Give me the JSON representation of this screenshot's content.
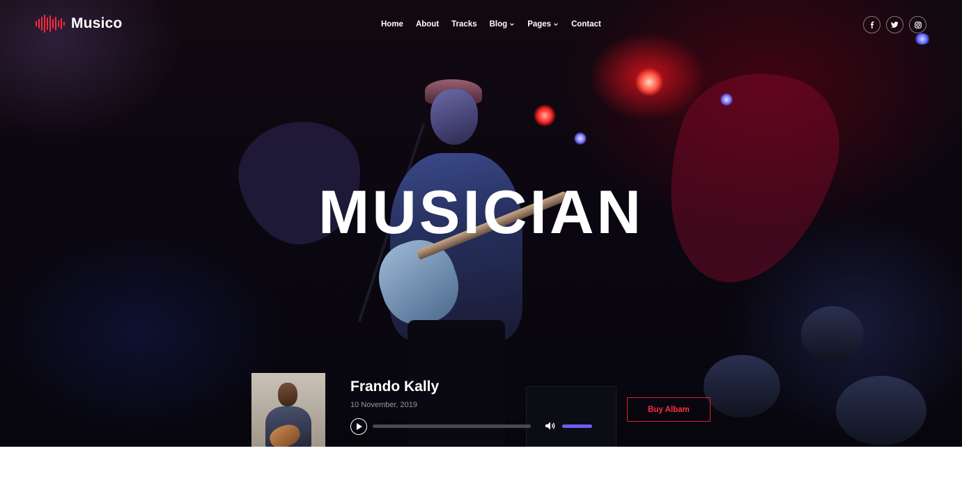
{
  "brand": {
    "name": "Musico",
    "accent": "#ff2a3c"
  },
  "nav": {
    "items": [
      {
        "label": "Home",
        "dropdown": false
      },
      {
        "label": "About",
        "dropdown": false
      },
      {
        "label": "Tracks",
        "dropdown": false
      },
      {
        "label": "Blog",
        "dropdown": true
      },
      {
        "label": "Pages",
        "dropdown": true
      },
      {
        "label": "Contact",
        "dropdown": false
      }
    ]
  },
  "socials": [
    {
      "icon": "facebook-icon",
      "glyph": "f"
    },
    {
      "icon": "twitter-icon",
      "glyph": "t"
    },
    {
      "icon": "instagram-icon",
      "glyph": "ig"
    }
  ],
  "hero": {
    "headline": "MUSICIAN"
  },
  "player": {
    "title": "Frando Kally",
    "date": "10 November, 2019",
    "progress": 0,
    "volume": 1.0,
    "volume_color": "#6c5cf2",
    "buy_label": "Buy Albam"
  }
}
